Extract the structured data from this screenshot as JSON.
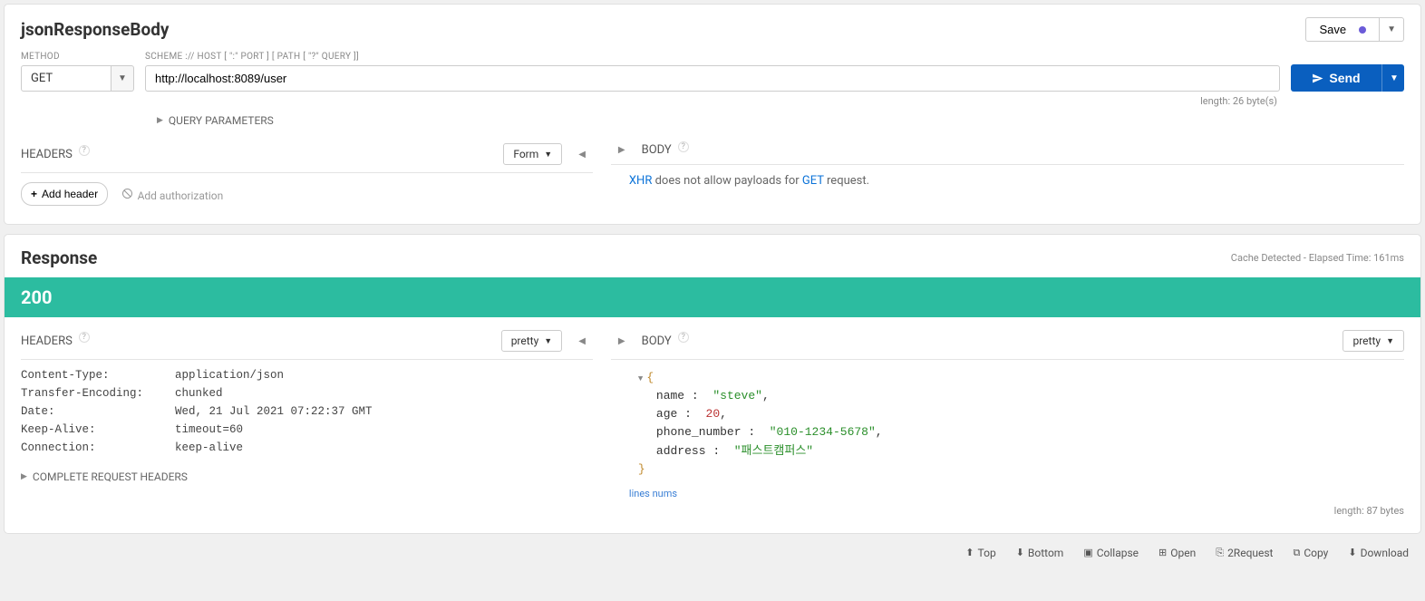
{
  "request": {
    "title": "jsonResponseBody",
    "save_label": "Save",
    "method_label": "METHOD",
    "method_value": "GET",
    "url_label": "SCHEME :// HOST [ \":\" PORT ] [ PATH [ \"?\" QUERY ]]",
    "url_value": "http://localhost:8089/user",
    "send_label": "Send",
    "length_text": "length: 26 byte(s)",
    "query_params_label": "QUERY PARAMETERS",
    "headers_label": "HEADERS",
    "form_dd_label": "Form",
    "add_header_label": "Add header",
    "add_auth_label": "Add authorization",
    "body_label": "BODY",
    "body_msg_xhr": "XHR",
    "body_msg_mid": " does not allow payloads for ",
    "body_msg_get": "GET",
    "body_msg_end": " request."
  },
  "response": {
    "title": "Response",
    "meta": "Cache Detected - Elapsed Time: 161ms",
    "status": "200",
    "headers_label": "HEADERS",
    "pretty_label": "pretty",
    "body_label": "BODY",
    "headers": [
      {
        "k": "Content-Type:",
        "v": "application/json"
      },
      {
        "k": "Transfer-Encoding:",
        "v": "chunked"
      },
      {
        "k": "Date:",
        "v": "Wed, 21 Jul 2021 07:22:37 GMT"
      },
      {
        "k": "Keep-Alive:",
        "v": "timeout=60"
      },
      {
        "k": "Connection:",
        "v": "keep-alive"
      }
    ],
    "complete_req_headers_label": "COMPLETE REQUEST HEADERS",
    "json": {
      "name_k": "name",
      "name_v": "\"steve\"",
      "age_k": "age",
      "age_v": "20",
      "phone_k": "phone_number",
      "phone_v": "\"010-1234-5678\"",
      "addr_k": "address",
      "addr_v": "\"패스트캠퍼스\""
    },
    "lines_nums_label": "lines nums",
    "body_length": "length: 87 bytes"
  },
  "footer": {
    "top": "Top",
    "bottom": "Bottom",
    "collapse": "Collapse",
    "open": "Open",
    "to_request": "2Request",
    "copy": "Copy",
    "download": "Download"
  }
}
